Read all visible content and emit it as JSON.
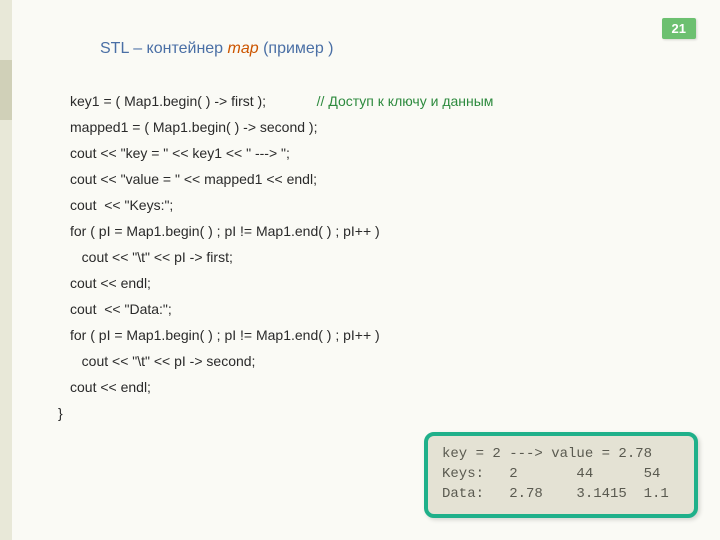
{
  "page_number": "21",
  "title_prefix": "STL – контейнер ",
  "title_em": "map",
  "title_suffix": "  (пример )",
  "code_lines": [
    {
      "text": "key1 = ( Map1.begin( ) -> first );",
      "comment": "             // Доступ к ключу и данным"
    },
    {
      "text": "mapped1 = ( Map1.begin( ) -> second );",
      "comment": ""
    },
    {
      "text": "cout << \"key = \" << key1 << \" ---> \";",
      "comment": ""
    },
    {
      "text": "cout << \"value = \" << mapped1 << endl;",
      "comment": ""
    },
    {
      "text": "",
      "comment": ""
    },
    {
      "text": "cout  << \"Keys:\";",
      "comment": ""
    },
    {
      "text": "for ( pI = Map1.begin( ) ; pI != Map1.end( ) ; pI++ )",
      "comment": ""
    },
    {
      "text": "   cout << \"\\t\" << pI -> first;",
      "comment": ""
    },
    {
      "text": "cout << endl;",
      "comment": ""
    },
    {
      "text": "",
      "comment": ""
    },
    {
      "text": "cout  << \"Data:\";",
      "comment": ""
    },
    {
      "text": "for ( pI = Map1.begin( ) ; pI != Map1.end( ) ; pI++ )",
      "comment": ""
    },
    {
      "text": "   cout << \"\\t\" << pI -> second;",
      "comment": ""
    },
    {
      "text": "cout << endl;",
      "comment": ""
    }
  ],
  "closing_brace": "}",
  "output_lines": [
    "key = 2 ---> value = 2.78",
    "Keys:   2       44      54",
    "Data:   2.78    3.1415  1.1"
  ]
}
